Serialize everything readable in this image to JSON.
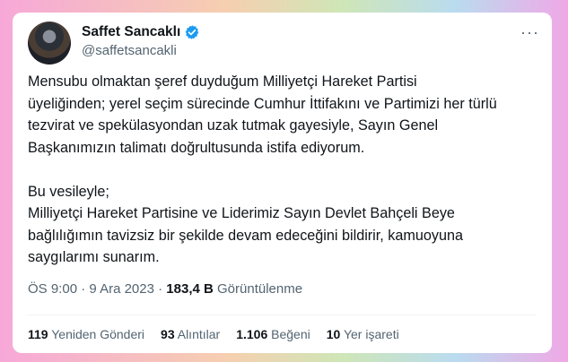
{
  "author": {
    "name": "Saffet Sancaklı",
    "handle": "@saffetsancakli"
  },
  "tweet": {
    "paragraph1": [
      "Mensubu olmaktan şeref duyduğum Milliyetçi Hareket Partisi",
      "üyeliğinden; yerel seçim sürecinde Cumhur İttifakını ve Partimizi her türlü",
      "tezvirat ve spekülasyondan uzak tutmak gayesiyle, Sayın Genel",
      "Başkanımızın talimatı doğrultusunda istifa ediyorum."
    ],
    "paragraph2": [
      "Bu vesileyle;",
      "Milliyetçi Hareket Partisine ve Liderimiz Sayın Devlet Bahçeli Beye",
      "bağlılığımın tavizsiz bir şekilde devam edeceğini bildirir, kamuoyuna",
      "saygılarımı sunarım."
    ]
  },
  "meta": {
    "time": "ÖS 9:00",
    "separator": "·",
    "date": "9 Ara 2023",
    "views_count": "183,4 B",
    "views_label": "Görüntülenme"
  },
  "stats": {
    "retweets_count": "119",
    "retweets_label": "Yeniden Gönderi",
    "quotes_count": "93",
    "quotes_label": "Alıntılar",
    "likes_count": "1.106",
    "likes_label": "Beğeni",
    "bookmarks_count": "10",
    "bookmarks_label": "Yer işareti"
  },
  "colors": {
    "verified": "#1d9bf0",
    "text": "#0f1419",
    "secondary": "#536471"
  },
  "icons": {
    "verified": "verified-badge-icon",
    "more": "more-options-icon"
  }
}
